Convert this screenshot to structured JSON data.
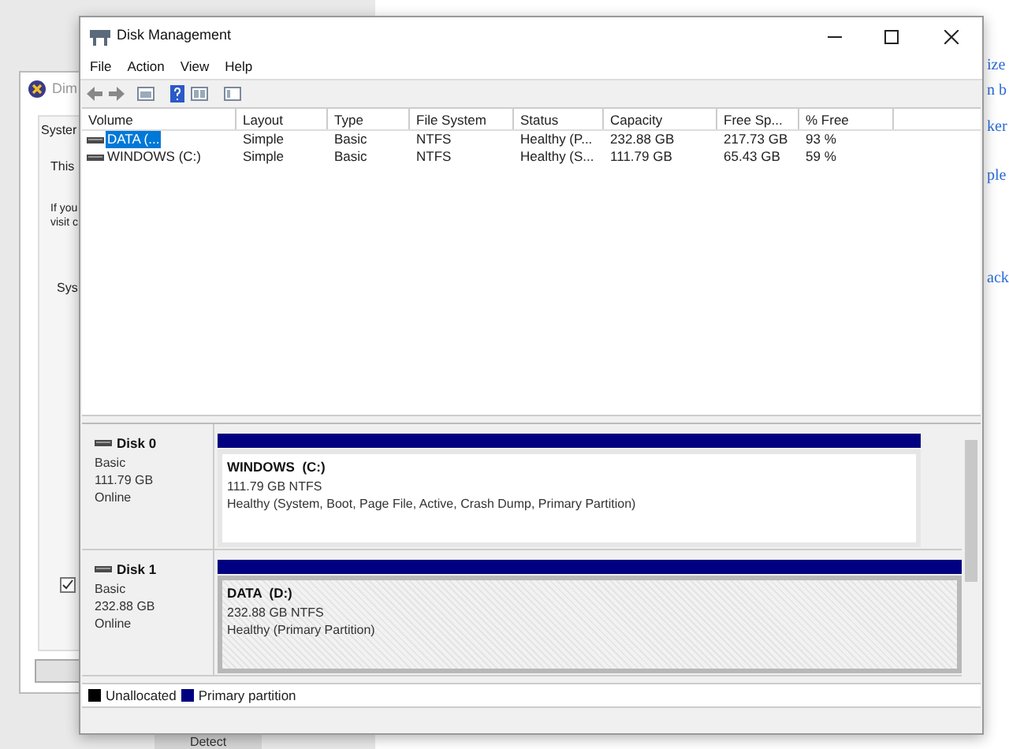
{
  "background_dialog": {
    "title": "Dim",
    "tab": "Syster",
    "texts": [
      "This",
      "If you",
      "visit c",
      "Sys"
    ],
    "checkbox": {
      "checked": true
    }
  },
  "background_page": {
    "links": [
      "ize",
      "n b",
      "ker",
      "ple",
      "ack"
    ],
    "button": "Detect"
  },
  "window": {
    "title": "Disk Management",
    "menu": [
      "File",
      "Action",
      "View",
      "Help"
    ]
  },
  "volumes": {
    "columns": [
      "Volume",
      "Layout",
      "Type",
      "File System",
      "Status",
      "Capacity",
      "Free Sp...",
      "% Free"
    ],
    "rows": [
      {
        "selected": true,
        "cells": [
          "DATA (...",
          "Simple",
          "Basic",
          "NTFS",
          "Healthy (P...",
          "232.88 GB",
          "217.73 GB",
          "93 %"
        ]
      },
      {
        "selected": false,
        "cells": [
          "WINDOWS (C:)",
          "Simple",
          "Basic",
          "NTFS",
          "Healthy (S...",
          "111.79 GB",
          "65.43 GB",
          "59 %"
        ]
      }
    ]
  },
  "disks": [
    {
      "name": "Disk 0",
      "type": "Basic",
      "size": "111.79 GB",
      "status": "Online",
      "partition": {
        "title": "WINDOWS  (C:)",
        "size": "111.79 GB NTFS",
        "status": "Healthy (System, Boot, Page File, Active, Crash Dump, Primary Partition)",
        "selected": false
      }
    },
    {
      "name": "Disk 1",
      "type": "Basic",
      "size": "232.88 GB",
      "status": "Online",
      "partition": {
        "title": "DATA  (D:)",
        "size": "232.88 GB NTFS",
        "status": "Healthy (Primary Partition)",
        "selected": true
      }
    }
  ],
  "legend": [
    {
      "label": "Unallocated",
      "color": "#000000"
    },
    {
      "label": "Primary partition",
      "color": "#000080"
    }
  ]
}
